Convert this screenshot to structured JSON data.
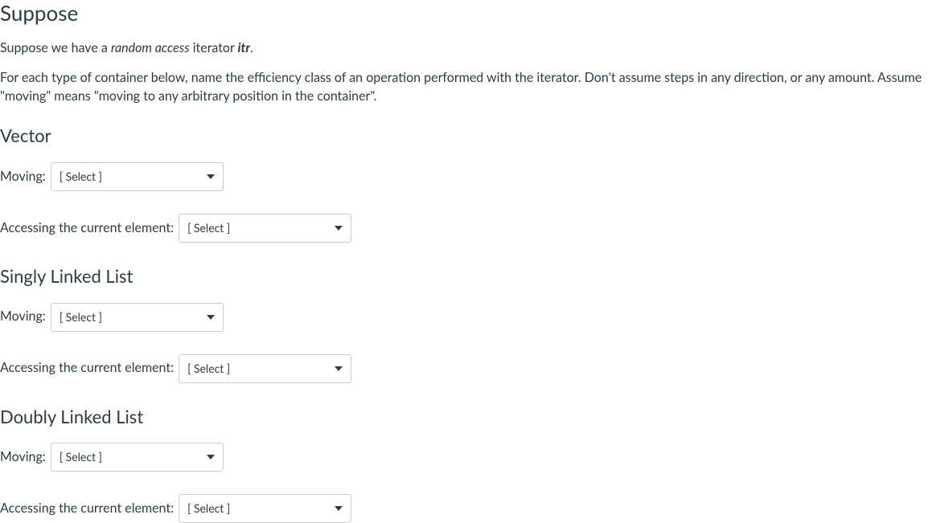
{
  "heading_main": "Suppose",
  "intro_paragraph": {
    "prefix": "Suppose we have a ",
    "em_span": "random access",
    "middle": " iterator ",
    "strong_span": "itr",
    "suffix": "."
  },
  "explain_paragraph": "For each type of container below, name the efficiency class of an operation performed with the iterator. Don't assume steps in any direction, or any amount. Assume \"moving\" means \"moving to any arbitrary position in the container\".",
  "sections": {
    "vector": {
      "heading": "Vector",
      "moving_label": "Moving:",
      "moving_value": "[ Select ]",
      "access_label": "Accessing the current element:",
      "access_value": "[ Select ]"
    },
    "singly": {
      "heading": "Singly Linked List",
      "moving_label": "Moving:",
      "moving_value": "[ Select ]",
      "access_label": "Accessing the current element:",
      "access_value": "[ Select ]"
    },
    "doubly": {
      "heading": "Doubly Linked List",
      "moving_label": "Moving:",
      "moving_value": "[ Select ]",
      "access_label": "Accessing the current element:",
      "access_value": "[ Select ]"
    }
  }
}
